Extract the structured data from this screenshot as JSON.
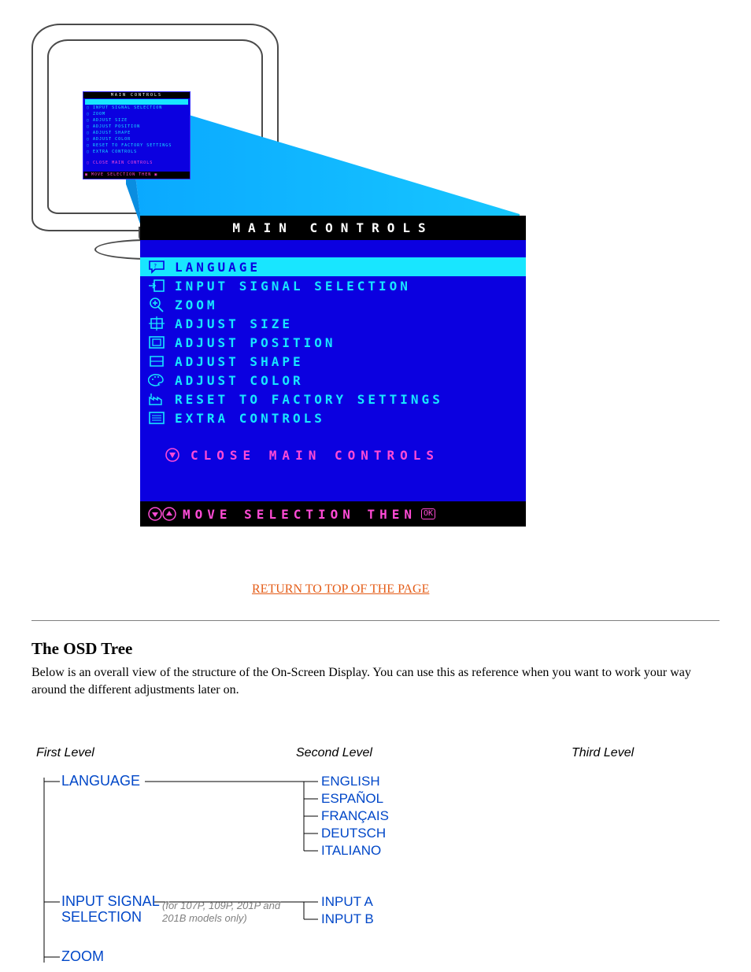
{
  "osd": {
    "title": "MAIN CONTROLS",
    "items": [
      {
        "label": "LANGUAGE",
        "icon": "speech-balloon-icon"
      },
      {
        "label": "INPUT SIGNAL SELECTION",
        "icon": "input-arrow-icon"
      },
      {
        "label": "ZOOM",
        "icon": "magnifier-plus-icon"
      },
      {
        "label": "ADJUST SIZE",
        "icon": "resize-arrows-icon"
      },
      {
        "label": "ADJUST POSITION",
        "icon": "screen-position-icon"
      },
      {
        "label": "ADJUST SHAPE",
        "icon": "screen-shape-icon"
      },
      {
        "label": "ADJUST COLOR",
        "icon": "palette-icon"
      },
      {
        "label": "RESET TO FACTORY SETTINGS",
        "icon": "factory-icon"
      },
      {
        "label": "EXTRA CONTROLS",
        "icon": "list-icon"
      }
    ],
    "close_label": "CLOSE MAIN CONTROLS",
    "footer_label": "MOVE SELECTION THEN",
    "footer_ok": "OK",
    "colors": {
      "bg": "#0b00e0",
      "highlight": "#18e6ff",
      "accent": "#ff4bd6",
      "title_bg": "#000000",
      "title_fg": "#ffffff"
    }
  },
  "link": {
    "return_top": "RETURN TO TOP OF THE PAGE"
  },
  "tree": {
    "heading": "The OSD Tree",
    "paragraph": "Below is an overall view of the structure of the On-Screen Display. You can use this as reference when you want to work your way around the different adjustments later on.",
    "columns": {
      "first": "First Level",
      "second": "Second Level",
      "third": "Third Level"
    },
    "language": {
      "label": "LANGUAGE",
      "options": [
        "ENGLISH",
        "ESPAÑOL",
        "FRANÇAIS",
        "DEUTSCH",
        "ITALIANO"
      ]
    },
    "input_signal": {
      "label_line1": "INPUT SIGNAL",
      "label_line2": "SELECTION",
      "note": "(for 107P, 109P, 201P and 201B models only)",
      "options": [
        "INPUT A",
        "INPUT B"
      ]
    },
    "zoom": {
      "label": "ZOOM"
    }
  }
}
